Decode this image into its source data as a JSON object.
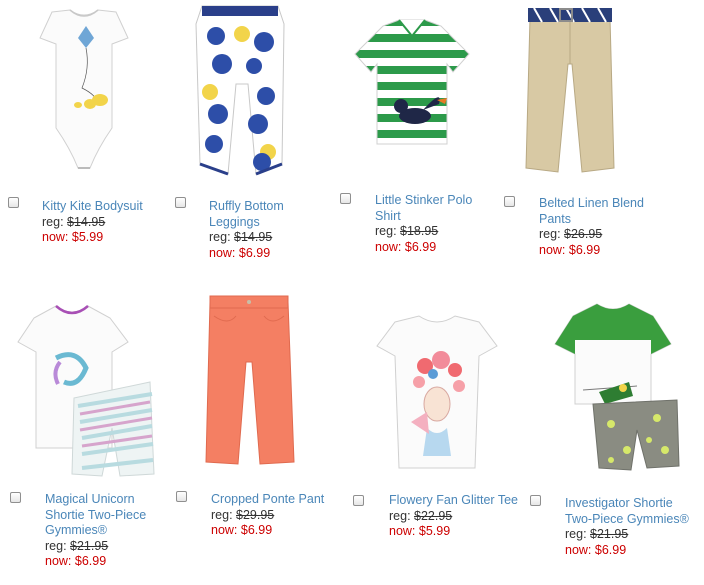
{
  "products": [
    {
      "name": "Kitty Kite Bodysuit",
      "reg_label": "reg:",
      "reg_price": "$14.95",
      "now_label": "now:",
      "now_price": "$5.99"
    },
    {
      "name": "Ruffly Bottom Leggings",
      "reg_label": "reg:",
      "reg_price": "$14.95",
      "now_label": "now:",
      "now_price": "$6.99"
    },
    {
      "name": "Little Stinker Polo Shirt",
      "reg_label": "reg:",
      "reg_price": "$18.95",
      "now_label": "now:",
      "now_price": "$6.99"
    },
    {
      "name": "Belted Linen Blend Pants",
      "reg_label": "reg:",
      "reg_price": "$26.95",
      "now_label": "now:",
      "now_price": "$6.99"
    },
    {
      "name": "Magical Unicorn Shortie Two-Piece Gymmies®",
      "reg_label": "reg:",
      "reg_price": "$21.95",
      "now_label": "now:",
      "now_price": "$6.99"
    },
    {
      "name": "Cropped Ponte Pant",
      "reg_label": "reg:",
      "reg_price": "$29.95",
      "now_label": "now:",
      "now_price": "$6.99"
    },
    {
      "name": "Flowery Fan Glitter Tee",
      "reg_label": "reg:",
      "reg_price": "$22.95",
      "now_label": "now:",
      "now_price": "$5.99"
    },
    {
      "name": "Investigator Shortie Two-Piece Gymmies®",
      "reg_label": "reg:",
      "reg_price": "$21.95",
      "now_label": "now:",
      "now_price": "$6.99"
    }
  ],
  "colors": {
    "link": "#4a86b8",
    "sale_price": "#cc0000",
    "reg_price": "#333333"
  }
}
